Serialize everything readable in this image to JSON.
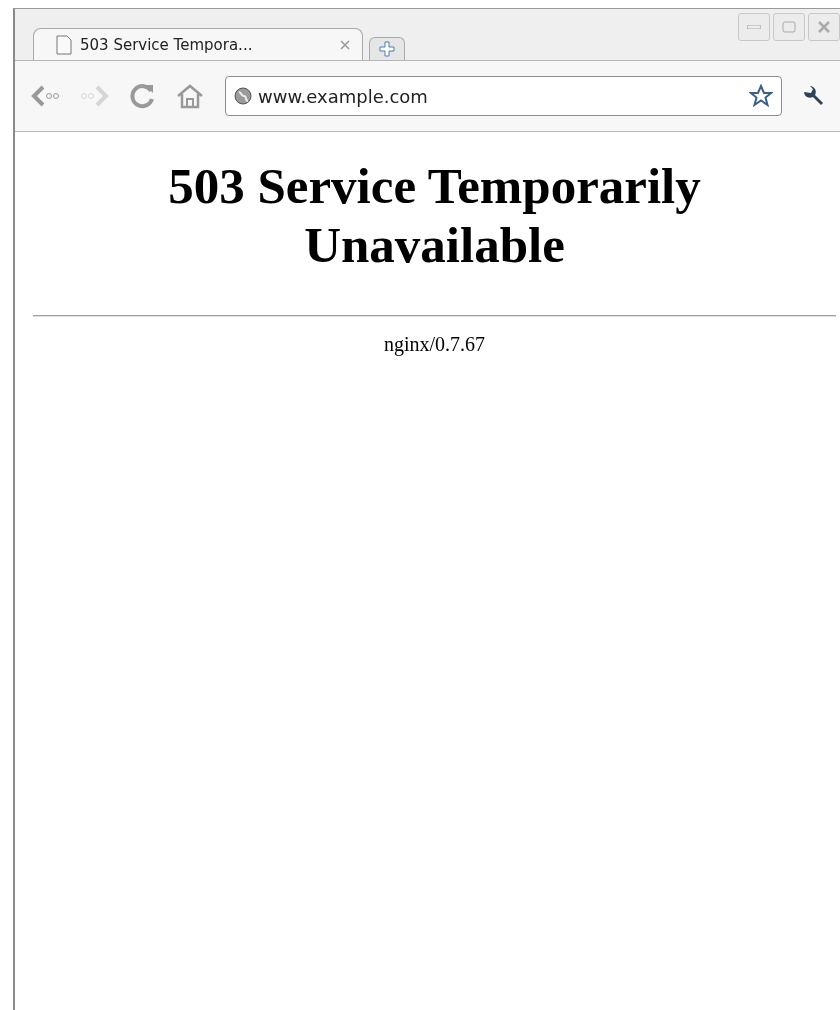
{
  "tabs": [
    {
      "title": "503 Service Tempora...",
      "selected": true
    }
  ],
  "toolbar": {
    "back": {
      "disabled": false
    },
    "forward": {
      "disabled": true
    },
    "address": {
      "value": "www.example.com"
    }
  },
  "page": {
    "heading": "503 Service Temporarily Unavailable",
    "server": "nginx/0.7.67"
  }
}
